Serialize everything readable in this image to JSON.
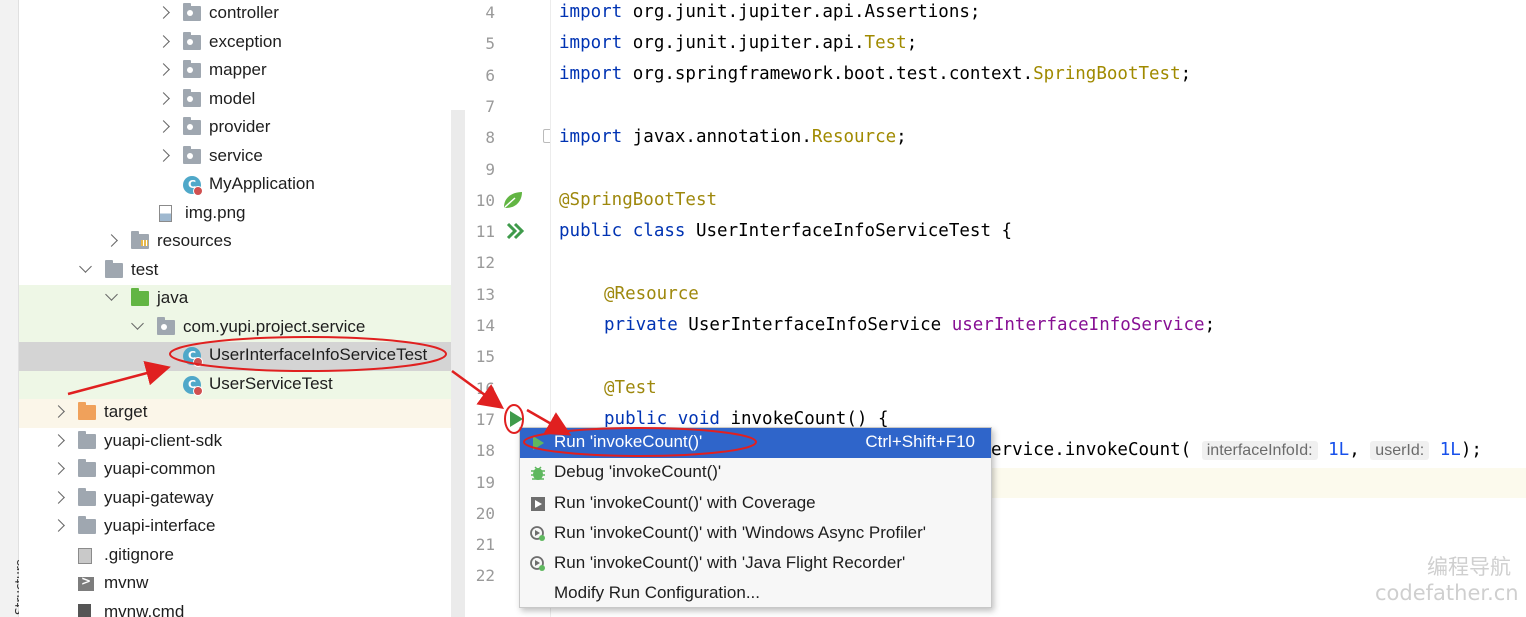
{
  "structure_tab": "Structure",
  "tree": [
    {
      "label": "controller",
      "kind": "pkg",
      "indent": 3,
      "chevron": "right"
    },
    {
      "label": "exception",
      "kind": "pkg",
      "indent": 3,
      "chevron": "right"
    },
    {
      "label": "mapper",
      "kind": "pkg",
      "indent": 3,
      "chevron": "right"
    },
    {
      "label": "model",
      "kind": "pkg",
      "indent": 3,
      "chevron": "right"
    },
    {
      "label": "provider",
      "kind": "pkg",
      "indent": 3,
      "chevron": "right"
    },
    {
      "label": "service",
      "kind": "pkg",
      "indent": 3,
      "chevron": "right"
    },
    {
      "label": "MyApplication",
      "kind": "class",
      "indent": 3,
      "chevron": "none"
    },
    {
      "label": "img.png",
      "kind": "img",
      "indent": 2,
      "chevron": "none"
    },
    {
      "label": "resources",
      "kind": "res",
      "indent": 1,
      "chevron": "right"
    },
    {
      "label": "test",
      "kind": "folder",
      "indent": 0,
      "chevron": "down"
    },
    {
      "label": "java",
      "kind": "green",
      "indent": 1,
      "chevron": "down"
    },
    {
      "label": "com.yupi.project.service",
      "kind": "pkg",
      "indent": 2,
      "chevron": "down"
    },
    {
      "label": "UserInterfaceInfoServiceTest",
      "kind": "class",
      "indent": 3,
      "chevron": "none"
    },
    {
      "label": "UserServiceTest",
      "kind": "class",
      "indent": 3,
      "chevron": "none"
    },
    {
      "label": "target",
      "kind": "orange",
      "indent": -1,
      "chevron": "right"
    },
    {
      "label": "yuapi-client-sdk",
      "kind": "folder",
      "indent": -1,
      "chevron": "right"
    },
    {
      "label": "yuapi-common",
      "kind": "folder",
      "indent": -1,
      "chevron": "right"
    },
    {
      "label": "yuapi-gateway",
      "kind": "folder",
      "indent": -1,
      "chevron": "right"
    },
    {
      "label": "yuapi-interface",
      "kind": "folder",
      "indent": -1,
      "chevron": "right"
    },
    {
      "label": ".gitignore",
      "kind": "git",
      "indent": -1,
      "chevron": "none"
    },
    {
      "label": "mvnw",
      "kind": "term",
      "indent": -1,
      "chevron": "none"
    },
    {
      "label": "mvnw.cmd",
      "kind": "cmd",
      "indent": -1,
      "chevron": "none"
    }
  ],
  "line_numbers": [
    "4",
    "5",
    "6",
    "7",
    "8",
    "9",
    "10",
    "11",
    "12",
    "13",
    "14",
    "15",
    "16",
    "17",
    "18",
    "19",
    "20",
    "21",
    "22"
  ],
  "code": {
    "l4": {
      "kw": "import",
      "rest": " org.junit.jupiter.api.Assertions;"
    },
    "l5": {
      "kw": "import",
      "rest": " org.junit.jupiter.api.",
      "typ": "Test",
      "end": ";"
    },
    "l6": {
      "kw": "import",
      "rest": " org.springframework.boot.test.context.",
      "typ": "SpringBootTest",
      "end": ";"
    },
    "l8": {
      "kw": "import",
      "rest": " javax.annotation.",
      "typ": "Resource",
      "end": ";"
    },
    "l10": {
      "ann": "@SpringBootTest"
    },
    "l11": {
      "kw": "public class",
      "rest": " UserInterfaceInfoServiceTest {"
    },
    "l13": {
      "ann": "@Resource"
    },
    "l14": {
      "kw": "private",
      "rest": " UserInterfaceInfoService ",
      "field": "userInterfaceInfoService",
      "end": ";"
    },
    "l16": {
      "ann": "@Test"
    },
    "l17": {
      "kw": "public void",
      "rest": " invokeCount() {"
    },
    "l18": {
      "rest": "ervice.invokeCount(",
      "hint1": "interfaceInfoId:",
      "num1": "1L",
      "sep": ",",
      "hint2": "userId:",
      "num2": "1L",
      "end": ");"
    }
  },
  "menu": {
    "items": [
      {
        "label": "Run 'invokeCount()'",
        "shortcut": "Ctrl+Shift+F10",
        "icon": "run-icon"
      },
      {
        "label": "Debug 'invokeCount()'",
        "shortcut": "",
        "icon": "debug-icon"
      },
      {
        "label": "Run 'invokeCount()' with Coverage",
        "shortcut": "",
        "icon": "coverage-icon"
      },
      {
        "label": "Run 'invokeCount()' with 'Windows Async Profiler'",
        "shortcut": "",
        "icon": "profiler-icon"
      },
      {
        "label": "Run 'invokeCount()' with 'Java Flight Recorder'",
        "shortcut": "",
        "icon": "flight-recorder-icon"
      },
      {
        "label": "Modify Run Configuration...",
        "shortcut": "",
        "icon": ""
      }
    ]
  },
  "watermark": {
    "line1": "编程导航",
    "line2": "codefather.cn"
  },
  "colors": {
    "menu_active": "#2f65ca",
    "annotation_red": "#e02020",
    "keyword": "#0033b3",
    "annotation": "#9e880d",
    "field": "#871094",
    "number": "#1750eb"
  }
}
